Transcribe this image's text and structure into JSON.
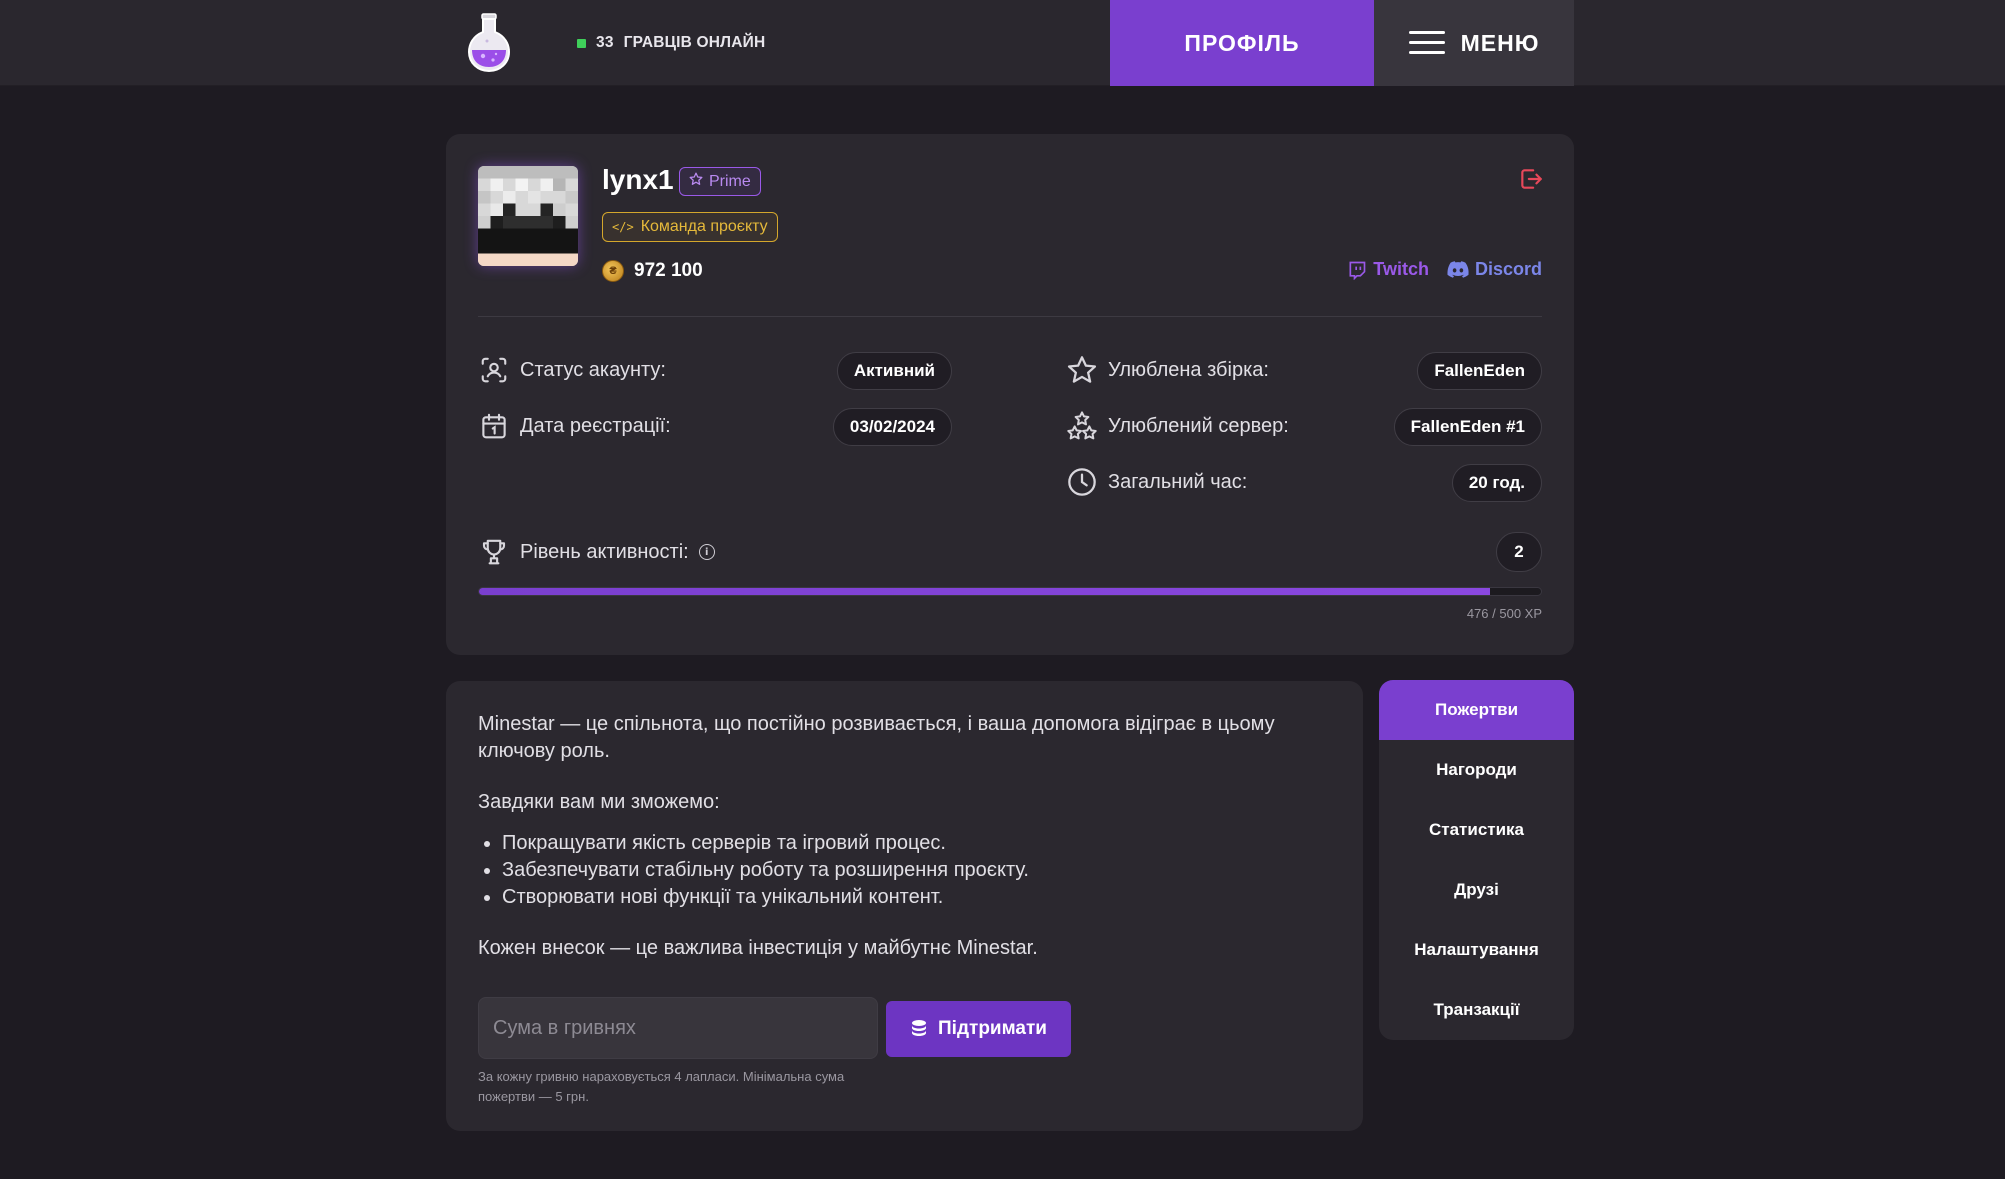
{
  "header": {
    "logo_icon": "potion-flask-icon",
    "online_count": "33",
    "online_label": "ГРАВЦІВ ОНЛАЙН",
    "profile_button": "ПРОФІЛЬ",
    "menu_button": "МЕНЮ",
    "accent_color": "#7a3fcf"
  },
  "profile": {
    "username": "lynx1",
    "prime_badge": "Prime",
    "team_badge": "Команда проєкту",
    "coins": "972 100",
    "twitch_label": "Twitch",
    "discord_label": "Discord",
    "stats_left": [
      {
        "icon": "user-scan-icon",
        "label": "Статус акаунту:",
        "value": "Активний"
      },
      {
        "icon": "calendar-icon",
        "label": "Дата реєстрації:",
        "value": "03/02/2024"
      }
    ],
    "stats_right": [
      {
        "icon": "star-icon",
        "label": "Улюблена збірка:",
        "value": "FallenEden"
      },
      {
        "icon": "stars-icon",
        "label": "Улюблений сервер:",
        "value": "FallenEden #1"
      },
      {
        "icon": "clock-icon",
        "label": "Загальний час:",
        "value": "20 год."
      }
    ],
    "activity_label": "Рівень активності:",
    "activity_level": "2",
    "xp_current": 476,
    "xp_max": 500,
    "xp_text": "476 / 500 XP"
  },
  "donate": {
    "intro": "Minestar — це спільнота, що постійно розвивається, і ваша допомога відіграє в цьому ключову роль.",
    "lead": "Завдяки вам ми зможемо:",
    "bullets": [
      "Покращувати якість серверів та ігровий процес.",
      "Забезпечувати стабільну роботу та розширення проєкту.",
      "Створювати нові функції та унікальний контент."
    ],
    "outro": "Кожен внесок — це важлива інвестиція у майбутнє Minestar.",
    "input_placeholder": "Сума в гривнях",
    "support_button": "Підтримати",
    "note": "За кожну гривню нараховується 4 лапласи. Мінімальна сума пожертви — 5 грн."
  },
  "tabs": [
    {
      "label": "Пожертви",
      "active": true
    },
    {
      "label": "Нагороди",
      "active": false
    },
    {
      "label": "Статистика",
      "active": false
    },
    {
      "label": "Друзі",
      "active": false
    },
    {
      "label": "Налаштування",
      "active": false
    },
    {
      "label": "Транзакції",
      "active": false
    }
  ]
}
